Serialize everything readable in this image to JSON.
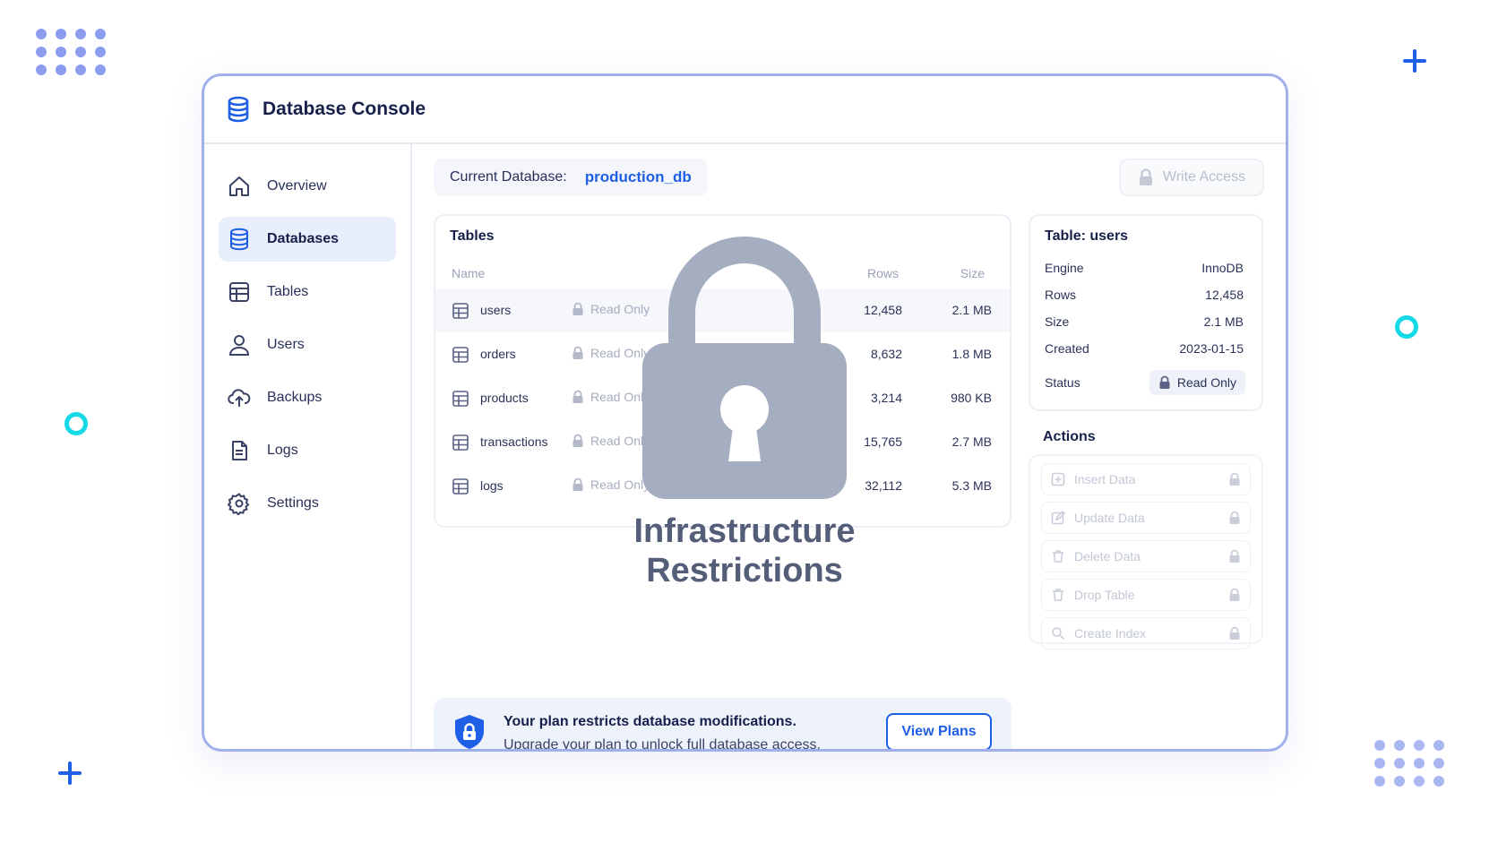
{
  "app": {
    "title": "Database Console"
  },
  "sidebar": {
    "items": [
      {
        "label": "Overview",
        "icon": "home-icon",
        "active": false
      },
      {
        "label": "Databases",
        "icon": "database-icon",
        "active": true
      },
      {
        "label": "Tables",
        "icon": "table-icon",
        "active": false
      },
      {
        "label": "Users",
        "icon": "user-icon",
        "active": false
      },
      {
        "label": "Backups",
        "icon": "cloud-upload-icon",
        "active": false
      },
      {
        "label": "Logs",
        "icon": "file-icon",
        "active": false
      },
      {
        "label": "Settings",
        "icon": "gear-icon",
        "active": false
      }
    ]
  },
  "header": {
    "current_db_label": "Current Database:",
    "current_db_value": "production_db",
    "write_access_label": "Write Access"
  },
  "tables": {
    "title": "Tables",
    "columns": {
      "name": "Name",
      "rows": "Rows",
      "size": "Size"
    },
    "rows": [
      {
        "name": "users",
        "status": "Read Only",
        "rows": "12,458",
        "size": "2.1 MB"
      },
      {
        "name": "orders",
        "status": "Read Only",
        "rows": "8,632",
        "size": "1.8 MB"
      },
      {
        "name": "products",
        "status": "Read Only",
        "rows": "3,214",
        "size": "980 KB"
      },
      {
        "name": "transactions",
        "status": "Read Only",
        "rows": "15,765",
        "size": "2.7 MB"
      },
      {
        "name": "logs",
        "status": "Read Only",
        "rows": "32,112",
        "size": "5.3 MB"
      }
    ]
  },
  "details": {
    "title": "Table: users",
    "fields": [
      {
        "label": "Engine",
        "value": "InnoDB"
      },
      {
        "label": "Rows",
        "value": "12,458"
      },
      {
        "label": "Size",
        "value": "2.1 MB"
      },
      {
        "label": "Created",
        "value": "2023-01-15"
      }
    ],
    "status_label": "Status",
    "status_value": "Read Only"
  },
  "actions": {
    "title": "Actions",
    "items": [
      {
        "label": "Insert Data",
        "icon": "plus-square-icon"
      },
      {
        "label": "Update Data",
        "icon": "edit-icon"
      },
      {
        "label": "Delete Data",
        "icon": "trash-icon"
      },
      {
        "label": "Drop Table",
        "icon": "trash-icon"
      },
      {
        "label": "Create Index",
        "icon": "search-icon"
      }
    ]
  },
  "overlay": {
    "line1": "Infrastructure",
    "line2": "Restrictions"
  },
  "banner": {
    "title": "Your plan restricts database modifications.",
    "subtitle": "Upgrade your plan to unlock full database access.",
    "button_label": "View Plans"
  },
  "colors": {
    "accent": "#1f5fe6",
    "navy": "#16204a",
    "muted": "#a6adbf",
    "lock_gray": "#a5adc0",
    "cyan": "#16d9e8"
  }
}
